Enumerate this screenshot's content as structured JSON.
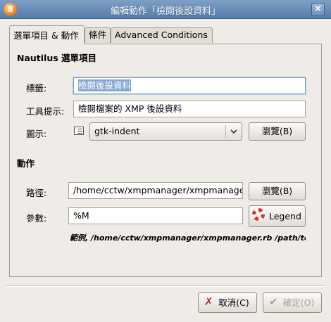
{
  "window": {
    "title": "編輯動作「檢閱後設資料」",
    "close_glyph": "×"
  },
  "tabs": [
    {
      "label": "選單項目 & 動作",
      "active": true
    },
    {
      "label": "條件",
      "active": false
    },
    {
      "label": "Advanced Conditions",
      "active": false
    }
  ],
  "menu_section": {
    "heading": "Nautilus 選單項目",
    "label_field": {
      "label": "標籤:",
      "value": "檢閱後設資料"
    },
    "tooltip_field": {
      "label": "工具提示:",
      "value": "檢閱檔案的 XMP 後設資料"
    },
    "icon_field": {
      "label": "圖示:",
      "icon": "indent-icon",
      "value": "gtk-indent",
      "browse_label": "瀏覽(B)"
    }
  },
  "action_section": {
    "heading": "動作",
    "path_field": {
      "label": "路徑:",
      "value": "/home/cctw/xmpmanager/xmpmanager.rb",
      "browse_label": "瀏覽(B)"
    },
    "params_field": {
      "label": "參數:",
      "value": "%M",
      "legend_label": "Legend",
      "legend_icon": "lifebuoy-icon"
    },
    "example_text": "範例, /home/cctw/xmpmanager/xmpmanager.rb /path/to/file"
  },
  "dialog_buttons": {
    "cancel": {
      "label": "取消(C)",
      "icon": "cancel-x-icon"
    },
    "ok": {
      "label": "確定(O)",
      "icon": "check-icon",
      "enabled": false
    }
  },
  "colors": {
    "titlebar": "#577cab",
    "selection": "#87a7d3",
    "background": "#efebe7"
  }
}
